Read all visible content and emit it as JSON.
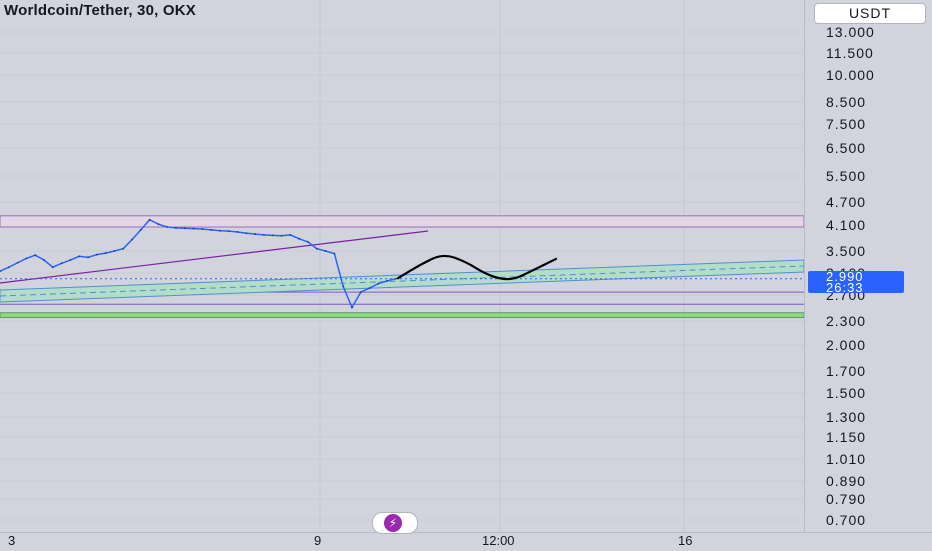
{
  "header": {
    "symbol": "Worldcoin/Tether, 30, OKX",
    "currency": "USDT"
  },
  "price_label": {
    "last_price": "2.990",
    "countdown": "26:33"
  },
  "colors": {
    "background": "#d1d4dc",
    "candles": "#2962ff",
    "resistance_zone": "#e1d5e7",
    "support_zone": "#8fd989",
    "channel_fill": "#b3ddc8",
    "trendline": "#7b1fa2",
    "price_line": "#2962ff",
    "projection": "#000000"
  },
  "logo_icon": "lightning-icon",
  "chart_data": {
    "type": "line",
    "title": "Worldcoin/Tether, 30, OKX",
    "xlabel": "",
    "ylabel": "",
    "log_scale": true,
    "grid": true,
    "ylim": [
      0.65,
      14.0
    ],
    "y_ticks": [
      {
        "value": 13.0,
        "label": "13.000"
      },
      {
        "value": 11.5,
        "label": "11.500"
      },
      {
        "value": 10.0,
        "label": "10.000"
      },
      {
        "value": 8.5,
        "label": "8.500"
      },
      {
        "value": 7.5,
        "label": "7.500"
      },
      {
        "value": 6.5,
        "label": "6.500"
      },
      {
        "value": 5.5,
        "label": "5.500"
      },
      {
        "value": 4.7,
        "label": "4.700"
      },
      {
        "value": 4.1,
        "label": "4.100"
      },
      {
        "value": 3.5,
        "label": "3.500"
      },
      {
        "value": 3.1,
        "label": "3.100"
      },
      {
        "value": 2.7,
        "label": "2.700"
      },
      {
        "value": 2.3,
        "label": "2.300"
      },
      {
        "value": 2.0,
        "label": "2.000"
      },
      {
        "value": 1.7,
        "label": "1.700"
      },
      {
        "value": 1.5,
        "label": "1.500"
      },
      {
        "value": 1.3,
        "label": "1.300"
      },
      {
        "value": 1.15,
        "label": "1.150"
      },
      {
        "value": 1.01,
        "label": "1.010"
      },
      {
        "value": 0.89,
        "label": "0.890"
      },
      {
        "value": 0.79,
        "label": "0.790"
      },
      {
        "value": 0.7,
        "label": "0.700"
      }
    ],
    "x_ticks": [
      "3",
      "9",
      "12:00",
      "16"
    ],
    "series": [
      {
        "values": [
          3.13,
          3.2,
          3.28,
          3.36,
          3.42,
          3.33,
          3.2,
          3.27,
          3.33,
          3.4,
          3.38,
          3.43,
          3.46,
          3.5,
          3.55,
          3.75,
          3.98,
          4.23,
          4.12,
          4.05,
          4.03,
          4.02,
          4.01,
          4.0,
          3.98,
          3.96,
          3.95,
          3.93,
          3.9,
          3.88,
          3.86,
          3.85,
          3.84,
          3.86,
          3.77,
          3.7,
          3.55,
          3.5,
          3.45,
          2.85,
          2.5,
          2.75,
          2.82,
          2.9,
          2.95,
          2.99
        ]
      }
    ],
    "zones": [
      {
        "name": "resistance",
        "from": 4.05,
        "to": 4.33
      },
      {
        "name": "support",
        "from": 2.35,
        "to": 2.42
      }
    ],
    "levels": [
      2.99,
      2.75,
      2.55
    ],
    "projection": [
      3.0,
      3.25,
      3.45,
      3.3,
      3.05,
      2.95,
      3.15,
      3.35
    ]
  }
}
